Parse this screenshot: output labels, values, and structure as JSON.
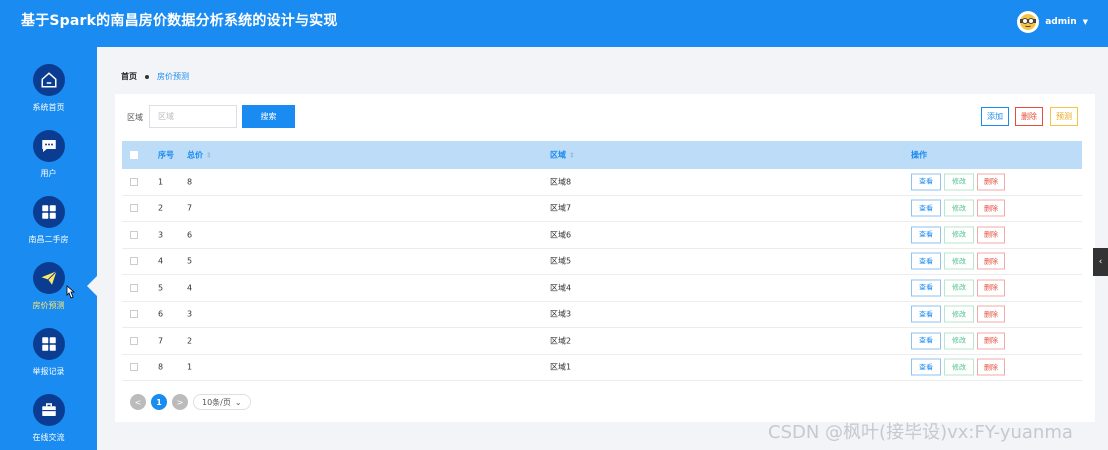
{
  "header": {
    "title": "基于Spark的南昌房价数据分析系统的设计与实现",
    "user": "admin",
    "caret": "▼"
  },
  "sidebar": {
    "items": [
      {
        "label": "系统首页",
        "icon": "home-icon"
      },
      {
        "label": "用户",
        "icon": "chat-icon"
      },
      {
        "label": "南昌二手房",
        "icon": "grid-icon"
      },
      {
        "label": "房价预测",
        "icon": "send-icon",
        "active": true
      },
      {
        "label": "举报记录",
        "icon": "grid-icon"
      },
      {
        "label": "在线交流",
        "icon": "briefcase-icon"
      }
    ]
  },
  "breadcrumb": {
    "home": "首页",
    "current": "房价预测"
  },
  "search": {
    "label": "区域",
    "placeholder": "区域",
    "button": "搜索"
  },
  "toolbar": {
    "add": "添加",
    "delete": "删除",
    "predict": "预测"
  },
  "table": {
    "headers": {
      "index": "序号",
      "price": "总价",
      "area": "区域",
      "ops": "操作"
    },
    "sort_icon": "⇕",
    "op_labels": {
      "view": "查看",
      "edit": "修改",
      "delete": "删除"
    },
    "rows": [
      {
        "index": "1",
        "price": "8",
        "area": "区域8"
      },
      {
        "index": "2",
        "price": "7",
        "area": "区域7"
      },
      {
        "index": "3",
        "price": "6",
        "area": "区域6"
      },
      {
        "index": "4",
        "price": "5",
        "area": "区域5"
      },
      {
        "index": "5",
        "price": "4",
        "area": "区域4"
      },
      {
        "index": "6",
        "price": "3",
        "area": "区域3"
      },
      {
        "index": "7",
        "price": "2",
        "area": "区域2"
      },
      {
        "index": "8",
        "price": "1",
        "area": "区域1"
      }
    ]
  },
  "pagination": {
    "prev": "<",
    "current": "1",
    "next": ">",
    "page_size": "10条/页",
    "dropdown": "⌄"
  },
  "side_toggle": "‹",
  "watermark": "CSDN @枫叶(接毕设)vx:FY-yuanma",
  "colors": {
    "primary": "#1a8bf0",
    "sidebar_icon_bg": "#0a3d91",
    "active_label": "#ffe76a",
    "table_header": "#bcdcf8",
    "danger": "#e74c3c",
    "success": "#4cc38a",
    "warning": "#f5c542"
  }
}
